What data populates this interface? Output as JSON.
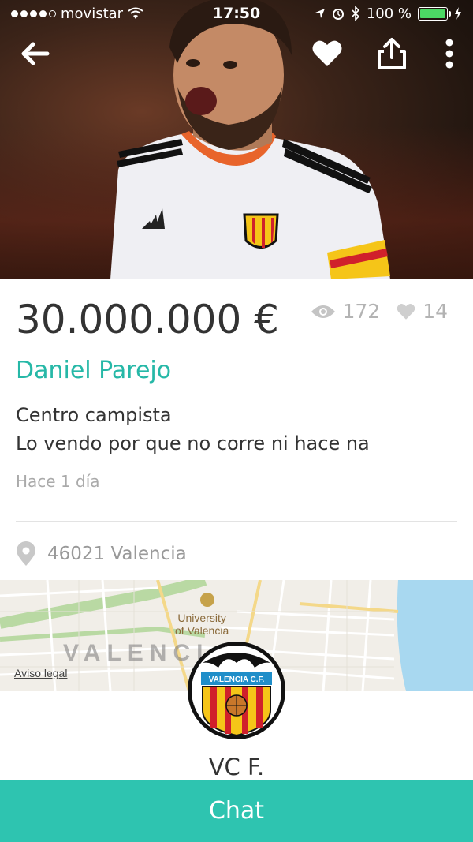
{
  "status_bar": {
    "carrier": "movistar",
    "time": "17:50",
    "battery_text": "100 %"
  },
  "nav": {
    "back_icon": "arrow-left-icon",
    "favorite_icon": "heart-icon",
    "share_icon": "share-icon",
    "more_icon": "more-vertical-icon"
  },
  "listing": {
    "price": "30.000.000 €",
    "views": "172",
    "likes": "14",
    "title": "Daniel Parejo",
    "description_line1": "Centro campista",
    "description_line2": "Lo vendo por que no corre ni hace na",
    "posted": "Hace 1 día",
    "location": "46021 Valencia"
  },
  "map": {
    "label_university_line1": "University",
    "label_university_line2": "of Valencia",
    "label_city": "VALENCI",
    "legal_link": "Aviso legal"
  },
  "seller": {
    "name": "VC F.",
    "badge_text": "VALENCIA C.F."
  },
  "actions": {
    "chat_label": "Chat"
  },
  "colors": {
    "accent": "#26b8a7",
    "chat_button": "#2ec4b0",
    "price_text": "#333333",
    "muted": "#aaaaaa"
  }
}
